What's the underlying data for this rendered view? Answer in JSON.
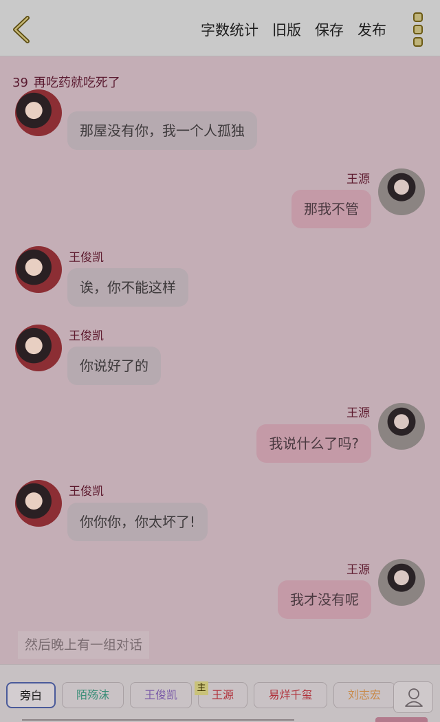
{
  "header": {
    "menu": [
      "字数统计",
      "旧版",
      "保存",
      "发布"
    ]
  },
  "chapter": {
    "number": "39",
    "title": "再吃药就吃死了"
  },
  "messages": [
    {
      "text": "那屋没有你，我一个人孤独"
    },
    {
      "name": "王源",
      "text": "那我不管"
    },
    {
      "name": "王俊凯",
      "text": "诶，你不能这样"
    },
    {
      "name": "王俊凯",
      "text": "你说好了的"
    },
    {
      "name": "王源",
      "text": "我说什么了吗?"
    },
    {
      "name": "王俊凯",
      "text": "你你你，你太坏了!"
    },
    {
      "name": "王源",
      "text": "我才没有呢"
    }
  ],
  "narration": "然后晚上有一组对话",
  "roles": [
    "旁白",
    "陌殇沫",
    "王俊凯",
    "王源",
    "易烊千玺",
    "刘志宏"
  ],
  "main_badge": "主",
  "colors": {
    "accent": "#4a5a9a",
    "role_teal": "#3b8e78",
    "role_purple": "#7a5aa8",
    "role_red": "#b0303a",
    "role_orange": "#c88a4a"
  }
}
